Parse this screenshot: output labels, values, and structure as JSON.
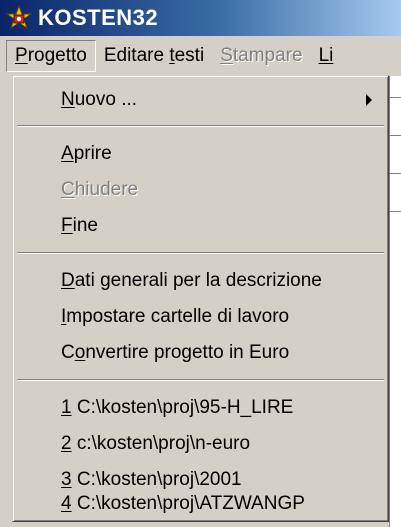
{
  "window": {
    "title": "KOSTEN32",
    "icon": "kosten-app-icon"
  },
  "menubar": {
    "items": [
      {
        "label_u": "P",
        "label_rest": "rogetto",
        "active": true
      },
      {
        "label_pre": "Editare ",
        "label_u": "t",
        "label_rest": "esti"
      },
      {
        "label_u": "S",
        "label_rest": "tampare",
        "disabled": true
      },
      {
        "label_u": "Li",
        "label_rest": ""
      }
    ]
  },
  "dropdown": {
    "items": [
      {
        "u": "N",
        "rest": "uovo ...",
        "submenu": true
      },
      {
        "u": "A",
        "rest": "prire"
      },
      {
        "u": "C",
        "rest": "hiudere",
        "disabled": true
      },
      {
        "u": "F",
        "rest": "ine"
      },
      {
        "u": "D",
        "rest": "ati generali per la descrizione"
      },
      {
        "u": "I",
        "rest": "mpostare cartelle di lavoro"
      },
      {
        "pre": "C",
        "u": "o",
        "rest": "nvertire progetto in Euro"
      },
      {
        "u": "1",
        "rest": " C:\\kosten\\proj\\95-H_LIRE"
      },
      {
        "u": "2",
        "rest": " c:\\kosten\\proj\\n-euro"
      },
      {
        "u": "3",
        "rest": " C:\\kosten\\proj\\2001"
      },
      {
        "u": "4",
        "rest": " C:\\kosten\\proj\\ATZWANGP"
      }
    ]
  },
  "colors": {
    "titlebar_start": "#0a246a",
    "titlebar_end": "#a6caf0",
    "face": "#d4d0c8",
    "disabled_text": "#808080"
  }
}
